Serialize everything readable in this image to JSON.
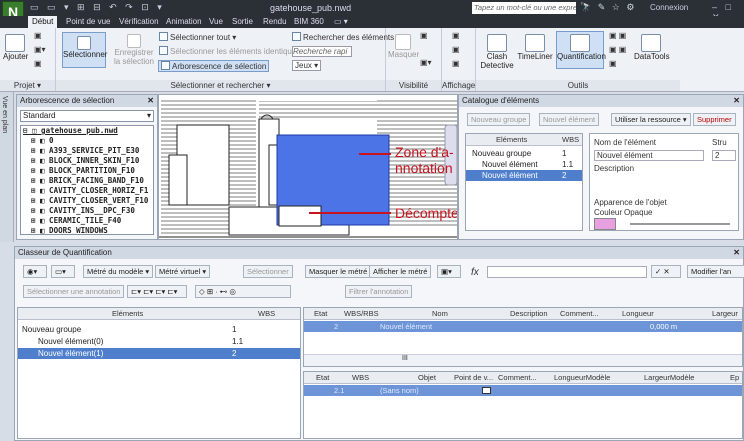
{
  "titlebar": {
    "app_letter": "N",
    "quick_access": "▭ ▭ ▾ ⊞ ⊟ ↶ ↷ ⊡ ▾",
    "window_title": "gatehouse_pub.nwd",
    "search_placeholder": "Tapez un mot-clé ou une expression",
    "search_icons": "🔭 ✎ ☆ ⚙",
    "signin": "Connexion",
    "help": "?",
    "window_controls": "– □ ✕"
  },
  "ribbon_tabs": [
    "Début",
    "Point de vue",
    "Vérification",
    "Animation",
    "Vue",
    "Sortie",
    "Rendu",
    "BIM 360",
    "▭ ▾"
  ],
  "ribbon": {
    "projet": {
      "label": "Projet ▾",
      "ajouter": "Ajouter"
    },
    "selection": {
      "label": "Sélectionner et rechercher ▾",
      "select": "Sélectionner",
      "save_sel": "Enregistrer la sélection",
      "select_all": "Sélectionner tout ▾",
      "select_same": "Sélectionner les éléments identiques ▾",
      "tree": "Arborescence de sélection",
      "find": "Rechercher des éléments",
      "quick_find": "Recherche rapi",
      "sets": "Jeux ▾"
    },
    "visibilite": {
      "label": "Visibilité",
      "masquer": "Masquer"
    },
    "affichage": {
      "label": "Affichage"
    },
    "outils": {
      "label": "Outils",
      "clash": "Clash Detective",
      "timeliner": "TimeLiner",
      "quantification": "Quantification",
      "datatools": "DataTools"
    }
  },
  "left_strip": "Vue en plan",
  "selection_tree": {
    "title": "Arborescence de sélection",
    "dropdown": "Standard",
    "items": [
      "⊟ ◫ gatehouse_pub.nwd",
      "⊞ ◧ 0",
      "⊞ ◧ A393_SERVICE_PIT_E30",
      "⊞ ◧ BLOCK_INNER_SKIN_F10",
      "⊞ ◧ BLOCK_PARTITION_F10",
      "⊞ ◧ BRICK_FACING_BAND_F10",
      "⊞ ◧ CAVITY_CLOSER_HORIZ_F1",
      "⊞ ◧ CAVITY_CLOSER_VERT_F10",
      "⊞ ◧ CAVITY_INS__DPC_F30",
      "⊞ ◧ CERAMIC_TILE_F40",
      "⊞ ◧ DOORS_WINDOWS"
    ]
  },
  "viewport": {
    "annotation1": "Zone d'a-",
    "annotation1b": "nnotation",
    "annotation2": "Décompte"
  },
  "catalogue": {
    "title": "Catalogue d'éléments",
    "btn_group": "Nouveau groupe",
    "btn_elem": "Nouvel élément",
    "btn_use": "Utiliser la ressource ▾",
    "btn_delete": "Supprimer",
    "col_elements": "Eléments",
    "col_wbs": "WBS",
    "rows": [
      {
        "name": "Nouveau groupe",
        "wbs": "1"
      },
      {
        "name": "Nouvel élément",
        "wbs": "1.1"
      },
      {
        "name": "Nouvel élément",
        "wbs": "2"
      }
    ],
    "prop_name_label": "Nom de l'élément",
    "prop_name_value": "Nouvel élément",
    "prop_stru_label": "Stru",
    "prop_stru_value": "2",
    "prop_desc": "Description",
    "prop_appearance": "Apparence de l'objet",
    "prop_color": "Couleur",
    "prop_opacity": "Opaque",
    "pink": "#e7a0e0"
  },
  "quant": {
    "title": "Classeur de Quantification",
    "tb1": [
      "Métré du modèle ▾",
      "Métré virtuel ▾",
      "Sélectionner",
      "Masquer le métré",
      "Afficher le métré",
      "Modifier l'an"
    ],
    "tb2": [
      "Sélectionner une annotation",
      "Filtrer l'annotation"
    ],
    "fx": "fx",
    "left_cols": [
      "Eléments",
      "WBS"
    ],
    "left_rows": [
      {
        "name": "Nouveau groupe",
        "wbs": "1"
      },
      {
        "name": "Nouvel élément(0)",
        "wbs": "1.1"
      },
      {
        "name": "Nouvel élément(1)",
        "wbs": "2"
      }
    ],
    "top_cols": [
      "Etat",
      "WBS/RBS",
      "Nom",
      "Description",
      "Comment...",
      "Longueur",
      "Largeur"
    ],
    "top_row": {
      "wbs": "2",
      "nom": "Nouvel élément",
      "longueur": "0,000 m"
    },
    "scroll_marker": "III",
    "bot_cols": [
      "Etat",
      "WBS",
      "Objet",
      "Point de v...",
      "Comment...",
      "LongueurModèle",
      "LargeurModèle",
      "Ep"
    ],
    "bot_row": {
      "wbs": "2.1",
      "objet": "(Sans nom)"
    }
  },
  "colors": {
    "accent": "#4f7fcc",
    "annotation_red": "#c8141e",
    "zone_blue": "#4d74e6"
  }
}
